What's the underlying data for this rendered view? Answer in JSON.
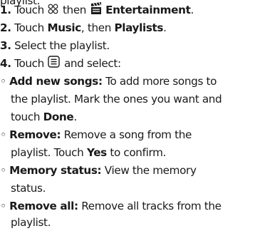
{
  "partial_line": "playlist.",
  "steps": [
    {
      "num": "1.",
      "before": "Touch",
      "mid": "then",
      "bold_end": "Entertainment",
      "end": "."
    },
    {
      "num": "2.",
      "before": "Touch",
      "bold1": "Music",
      "mid": ", then",
      "bold2": "Playlists",
      "end": "."
    },
    {
      "num": "3.",
      "text": "Select the playlist."
    },
    {
      "num": "4.",
      "before": "Touch",
      "after": "and select:"
    }
  ],
  "icons": [
    "apps-menu-icon",
    "entertainment-clapperboard-icon",
    "options-menu-icon"
  ],
  "options": [
    {
      "bullet": "◦",
      "title": "Add new songs:",
      "line1": "To add more songs to",
      "line2": "the playlist. Mark the ones you want and",
      "line3_pre": "touch",
      "line3_bold": "Done",
      "line3_post": "."
    },
    {
      "bullet": "◦",
      "title": "Remove:",
      "line1": "Remove a song from the",
      "line2_pre": "playlist. Touch",
      "line2_bold": "Yes",
      "line2_post": "to confirm."
    },
    {
      "bullet": "◦",
      "title": "Memory status:",
      "line1": "View the memory",
      "line2": "status."
    },
    {
      "bullet": "◦",
      "title": "Remove all:",
      "line1": "Remove all tracks from the",
      "line2": "playlist."
    }
  ]
}
